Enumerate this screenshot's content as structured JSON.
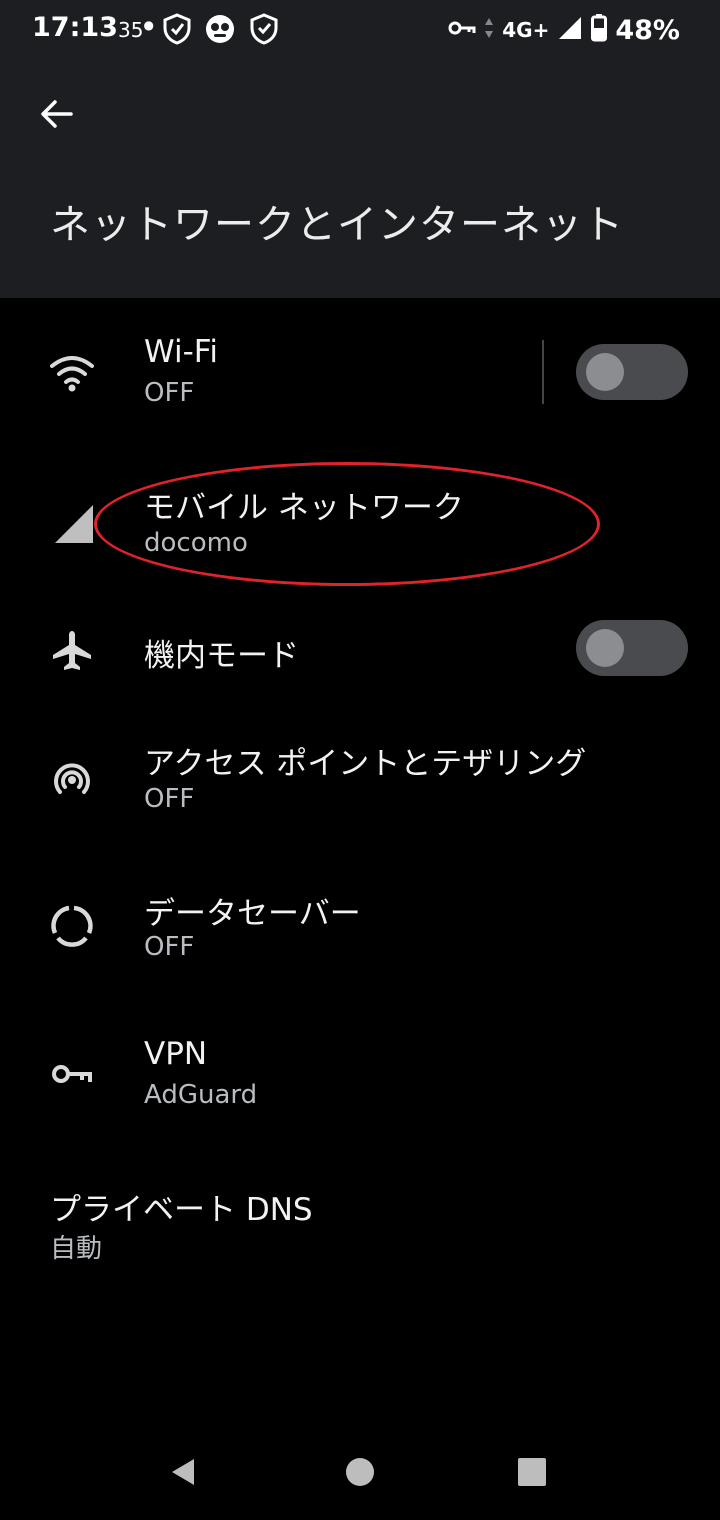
{
  "status_bar": {
    "time": "17:13",
    "temperature": "35",
    "network": "4G+",
    "battery": "48%"
  },
  "header": {
    "title": "ネットワークとインターネット"
  },
  "items": [
    {
      "title": "Wi-Fi",
      "subtitle": "OFF",
      "icon": "wifi-icon",
      "toggle": false
    },
    {
      "title": "モバイル ネットワーク",
      "subtitle": "docomo",
      "icon": "signal-icon"
    },
    {
      "title": "機内モード",
      "icon": "airplane-icon",
      "toggle": false
    },
    {
      "title": "アクセス ポイントとテザリング",
      "subtitle": "OFF",
      "icon": "hotspot-icon"
    },
    {
      "title": "データセーバー",
      "subtitle": "OFF",
      "icon": "data-saver-icon"
    },
    {
      "title": "VPN",
      "subtitle": "AdGuard",
      "icon": "vpn-key-icon"
    },
    {
      "title": "プライベート DNS",
      "subtitle": "自動"
    }
  ],
  "colors": {
    "app_bar": "#1c1e21",
    "background": "#000000",
    "highlight": "#e0222a",
    "toggle_track": "#4a4b4e"
  }
}
